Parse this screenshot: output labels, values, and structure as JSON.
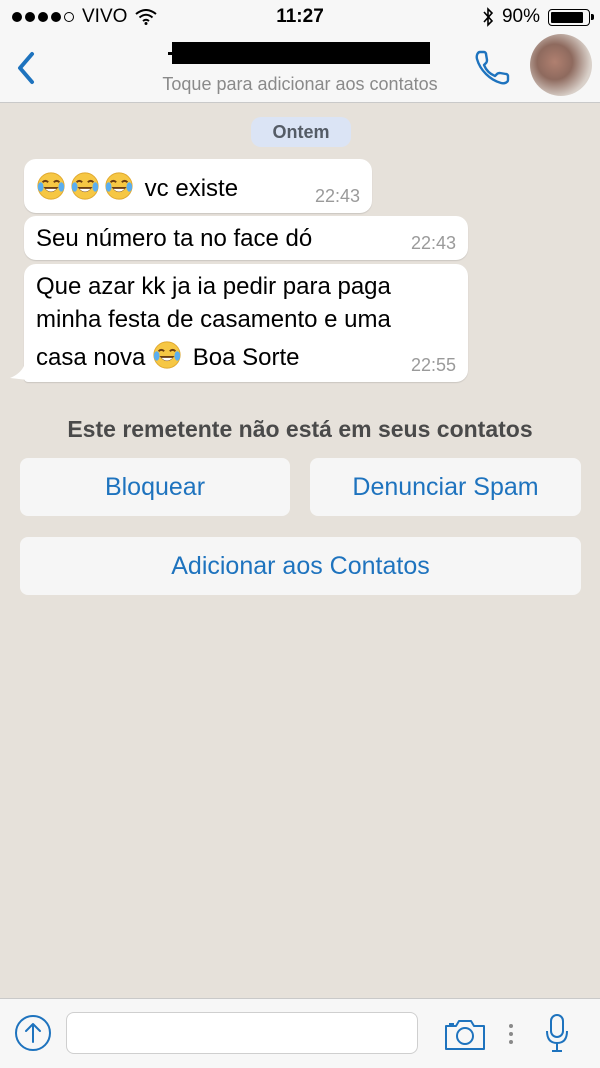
{
  "status_bar": {
    "carrier": "VIVO",
    "time": "11:27",
    "battery_text": "90%",
    "battery_level": 0.9,
    "signal_bars_filled": 4,
    "signal_bars_total": 5
  },
  "header": {
    "subtitle": "Toque para adicionar aos contatos"
  },
  "chat": {
    "date_label": "Ontem",
    "messages": [
      {
        "text": "vc existe",
        "time": "22:43",
        "emoji_prefix_count": 3
      },
      {
        "text": "Seu número ta no face dó",
        "time": "22:43"
      },
      {
        "lines": [
          "Que azar kk ja ia pedir para paga",
          "minha festa de casamento e uma",
          "casa nova",
          "Boa Sorte"
        ],
        "time": "22:55"
      }
    ]
  },
  "spam_panel": {
    "notice": "Este remetente não está em seus contatos",
    "block_label": "Bloquear",
    "spam_label": "Denunciar Spam",
    "add_label": "Adicionar aos Contatos"
  },
  "input_bar": {
    "placeholder": "",
    "value": ""
  },
  "colors": {
    "accent": "#1e73be",
    "chat_background": "#e6e1da",
    "date_badge": "#dbe4f5"
  },
  "icons": [
    "back-chevron-icon",
    "phone-icon",
    "upload-arrow-icon",
    "camera-icon",
    "more-dots-icon",
    "microphone-icon",
    "bluetooth-icon",
    "wifi-icon",
    "laughing-crying-emoji-icon"
  ]
}
